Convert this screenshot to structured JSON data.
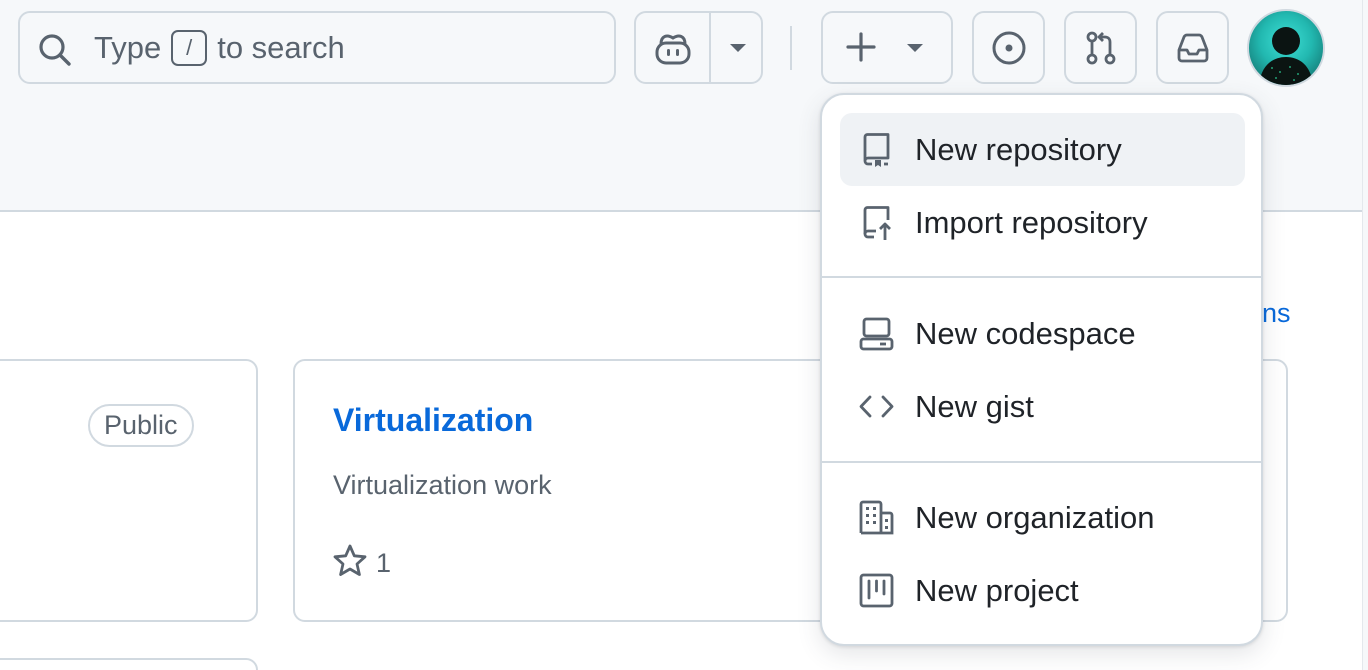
{
  "search": {
    "prefix": "Type",
    "key": "/",
    "suffix": "to search",
    "icon": "search-icon"
  },
  "header_buttons": {
    "copilot_icon": "copilot-icon",
    "create_icon": "plus-icon",
    "issues_icon": "issue-opened-icon",
    "pull_requests_icon": "git-pull-request-icon",
    "inbox_icon": "inbox-icon"
  },
  "create_menu": {
    "groups": [
      [
        {
          "label": "New repository",
          "icon": "repo-icon"
        },
        {
          "label": "Import repository",
          "icon": "repo-push-icon"
        }
      ],
      [
        {
          "label": "New codespace",
          "icon": "codespaces-icon"
        },
        {
          "label": "New gist",
          "icon": "code-icon"
        }
      ],
      [
        {
          "label": "New organization",
          "icon": "organization-icon"
        },
        {
          "label": "New project",
          "icon": "project-icon"
        }
      ]
    ]
  },
  "repos": [
    {
      "visibility": "Public"
    },
    {
      "name": "Virtualization",
      "description": "Virtualization work",
      "stars": "1"
    }
  ],
  "partial_link_text": "ns",
  "colors": {
    "accent": "#0969da",
    "header_bg": "#f6f8fa",
    "border": "#d1d9e0",
    "menu_active_bg": "#eff2f5"
  }
}
